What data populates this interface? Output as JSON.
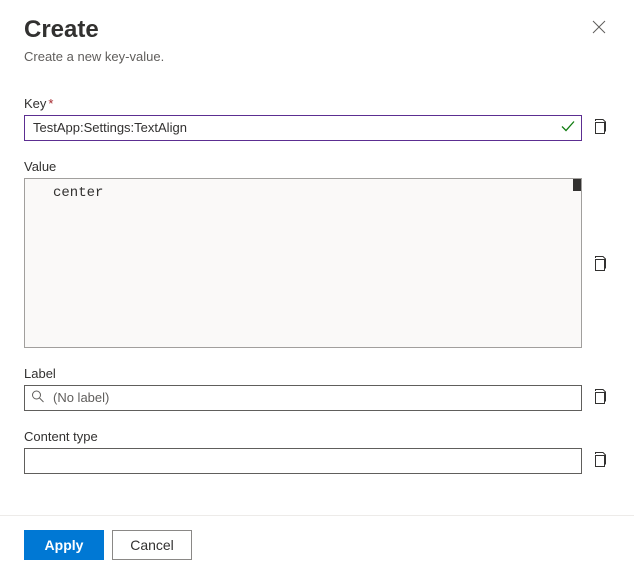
{
  "header": {
    "title": "Create",
    "subtitle": "Create a new key-value."
  },
  "fields": {
    "key": {
      "label": "Key",
      "required_marker": "*",
      "value": "TestApp:Settings:TextAlign"
    },
    "value": {
      "label": "Value",
      "value": "center"
    },
    "label": {
      "label": "Label",
      "placeholder": "(No label)",
      "value": ""
    },
    "contentType": {
      "label": "Content type",
      "value": ""
    }
  },
  "footer": {
    "apply": "Apply",
    "cancel": "Cancel"
  }
}
